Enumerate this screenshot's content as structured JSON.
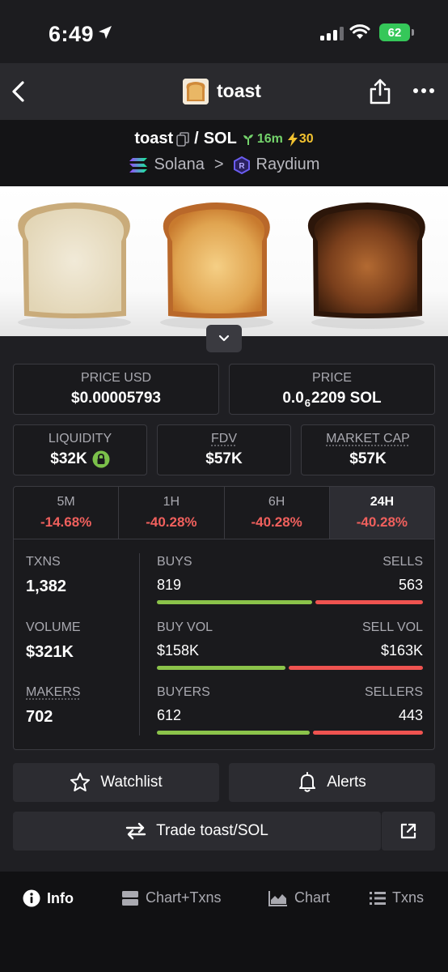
{
  "status_bar": {
    "time": "6:49",
    "battery": "62"
  },
  "header": {
    "title": "toast"
  },
  "pair": {
    "base": "toast",
    "separator": "/",
    "quote": "SOL",
    "age": "16m",
    "boosts": "30",
    "chain": "Solana",
    "chevron": ">",
    "dex": "Raydium"
  },
  "price_usd": {
    "label": "PRICE USD",
    "value": "$0.00005793"
  },
  "price_native": {
    "label": "PRICE",
    "prefix": "0.0",
    "zeros": "6",
    "digits": "2209",
    "unit": "SOL"
  },
  "liquidity": {
    "label": "LIQUIDITY",
    "value": "$32K"
  },
  "fdv": {
    "label": "FDV",
    "value": "$57K"
  },
  "market_cap": {
    "label": "MARKET CAP",
    "value": "$57K"
  },
  "timeframes": [
    {
      "label": "5M",
      "change": "-14.68%"
    },
    {
      "label": "1H",
      "change": "-40.28%"
    },
    {
      "label": "6H",
      "change": "-40.28%"
    },
    {
      "label": "24H",
      "change": "-40.28%",
      "active": true
    }
  ],
  "stats": {
    "txns": {
      "label": "TXNS",
      "value": "1,382"
    },
    "volume": {
      "label": "VOLUME",
      "value": "$321K"
    },
    "makers": {
      "label": "MAKERS",
      "value": "702"
    },
    "buys": {
      "label": "BUYS",
      "value": "819"
    },
    "sells": {
      "label": "SELLS",
      "value": "563"
    },
    "buy_vol": {
      "label": "BUY VOL",
      "value": "$158K"
    },
    "sell_vol": {
      "label": "SELL VOL",
      "value": "$163K"
    },
    "buyers": {
      "label": "BUYERS",
      "value": "612"
    },
    "sellers": {
      "label": "SELLERS",
      "value": "443"
    },
    "buy_share": {
      "txns": 0.59,
      "volume": 0.49,
      "makers": 0.58
    }
  },
  "actions": {
    "watchlist": "Watchlist",
    "alerts": "Alerts",
    "trade": "Trade toast/SOL"
  },
  "nav": {
    "info": "Info",
    "chart_txns": "Chart+Txns",
    "chart": "Chart",
    "txns": "Txns"
  },
  "colors": {
    "positive": "#8bc34a",
    "negative": "#ef5350",
    "age_green": "#74d36b",
    "boost_yellow": "#f2c230"
  }
}
